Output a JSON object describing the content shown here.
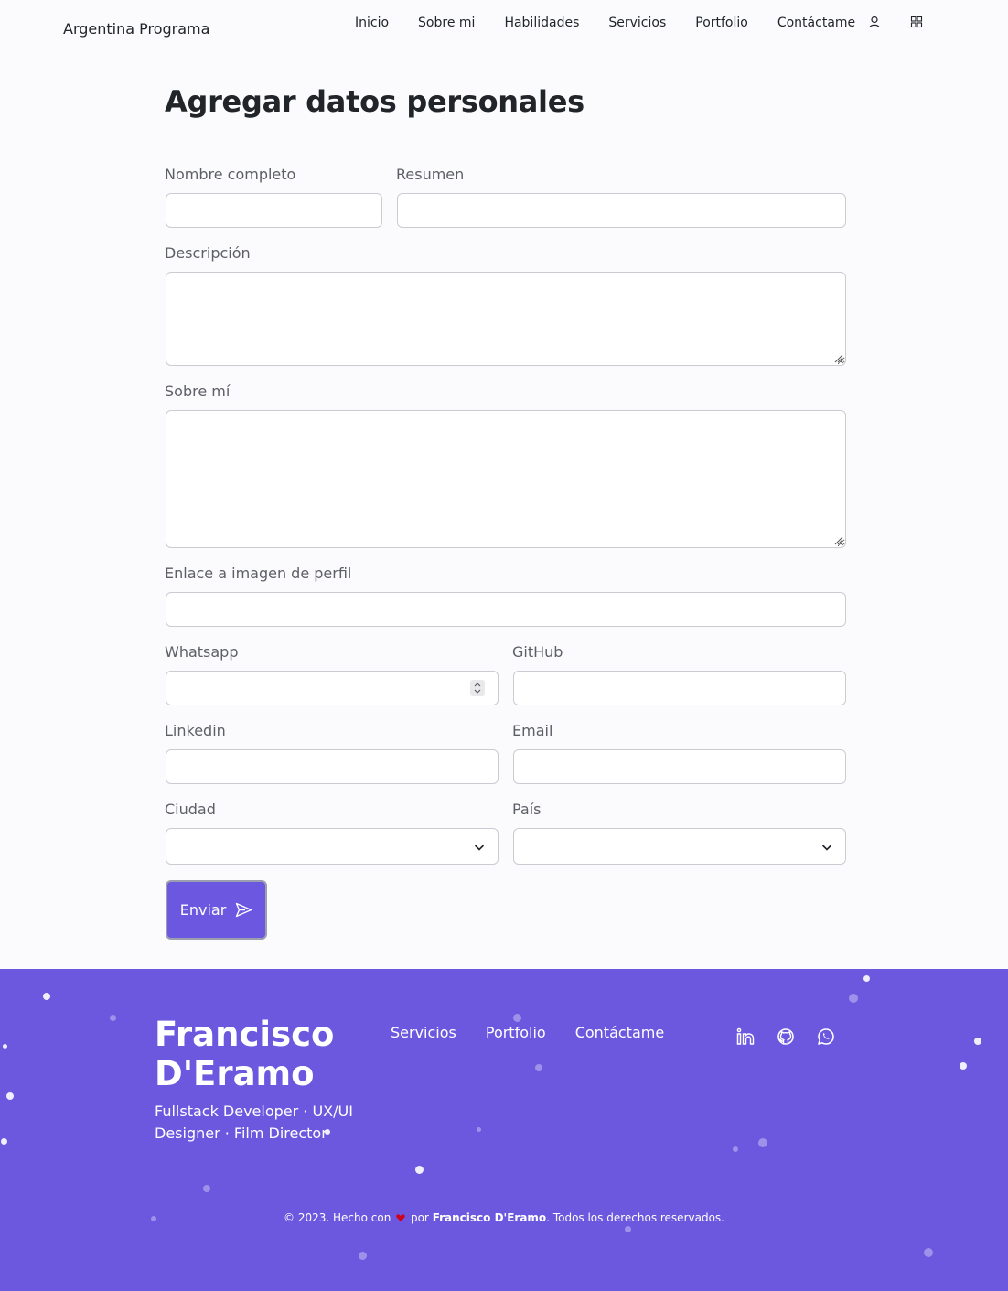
{
  "navbar": {
    "brand": "Argentina Programa",
    "links": [
      "Inicio",
      "Sobre mi",
      "Habilidades",
      "Servicios",
      "Portfolio",
      "Contáctame"
    ],
    "icons": [
      "user-icon",
      "grid-icon"
    ]
  },
  "form": {
    "title": "Agregar datos personales",
    "labels": {
      "nombre": "Nombre completo",
      "resumen": "Resumen",
      "descripcion": "Descripción",
      "sobre_mi": "Sobre mí",
      "imagen": "Enlace a imagen de perfil",
      "whatsapp": "Whatsapp",
      "github": "GitHub",
      "linkedin": "Linkedin",
      "email": "Email",
      "ciudad": "Ciudad",
      "pais": "País"
    },
    "values": {
      "nombre": "",
      "resumen": "",
      "descripcion": "",
      "sobre_mi": "",
      "imagen": "",
      "whatsapp": "",
      "github": "",
      "linkedin": "",
      "email": "",
      "ciudad": "",
      "pais": ""
    },
    "submit_label": "Enviar",
    "submit_icon": "send-icon"
  },
  "footer": {
    "name": "Francisco D'Eramo",
    "role": "Fullstack Developer · UX/UI Designer · Film Director",
    "links": [
      "Servicios",
      "Portfolio",
      "Contáctame"
    ],
    "social_icons": [
      "linkedin-icon",
      "github-icon",
      "whatsapp-icon"
    ],
    "copyright_prefix": "© 2023. Hecho con",
    "copyright_by": "por",
    "copyright_author": "Francisco D'Eramo",
    "copyright_suffix": ". Todos los derechos reservados."
  },
  "colors": {
    "accent": "#6c57df",
    "heart": "#d0021b"
  }
}
